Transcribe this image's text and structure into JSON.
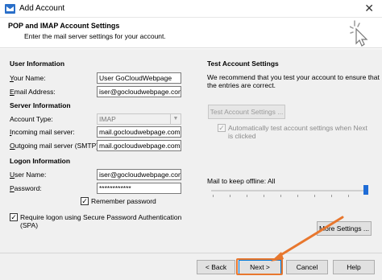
{
  "window": {
    "title": "Add Account",
    "close_glyph": "✕"
  },
  "header": {
    "title": "POP and IMAP Account Settings",
    "subtitle": "Enter the mail server settings for your account."
  },
  "user_info": {
    "heading": "User Information",
    "name_label_u": "Y",
    "name_label_rest": "our Name:",
    "name_value": "User GoCloudWebpage",
    "email_label_u": "E",
    "email_label_rest": "mail Address:",
    "email_value": "iser@gocloudwebpage.com"
  },
  "server_info": {
    "heading": "Server Information",
    "type_label_pre": "Account Type:",
    "type_value": "IMAP",
    "incoming_label_u": "I",
    "incoming_label_rest": "ncoming mail server:",
    "incoming_value": "mail.gocloudwebpage.com",
    "outgoing_label_u": "O",
    "outgoing_label_rest": "utgoing mail server (SMTP):",
    "outgoing_value": "mail.gocloudwebpage.com"
  },
  "logon_info": {
    "heading": "Logon Information",
    "username_label_u": "U",
    "username_label_rest": "ser Name:",
    "username_value": "iser@gocloudwebpage.com",
    "password_label_u": "P",
    "password_label_rest": "assword:",
    "password_value": "************",
    "remember_label": "Remember password",
    "remember_checked": true,
    "spa_label_line1": "Require logon using Secure Password Authentication",
    "spa_label_line2": "(SPA)",
    "spa_checked": true
  },
  "test_settings": {
    "heading": "Test Account Settings",
    "description_line1": "We recommend that you test your account to ensure that",
    "description_line2": "the entries are correct.",
    "test_button": "Test Account Settings ...",
    "auto_test_line1": "Automatically test account settings when Next",
    "auto_test_line2": "is clicked",
    "auto_test_checked": true
  },
  "offline": {
    "label": "Mail to keep offline:",
    "value": "All"
  },
  "more_settings_button": "More Settings ...",
  "footer": {
    "back": "< Back",
    "next": "Next >",
    "cancel": "Cancel",
    "help": "Help"
  },
  "colors": {
    "annotation": "#e8772e",
    "accent": "#1f6cd6"
  },
  "icons": {
    "app": "outlook-mail-icon",
    "close": "close-icon",
    "cursor": "pointer-cursor-icon",
    "check": "✓"
  }
}
